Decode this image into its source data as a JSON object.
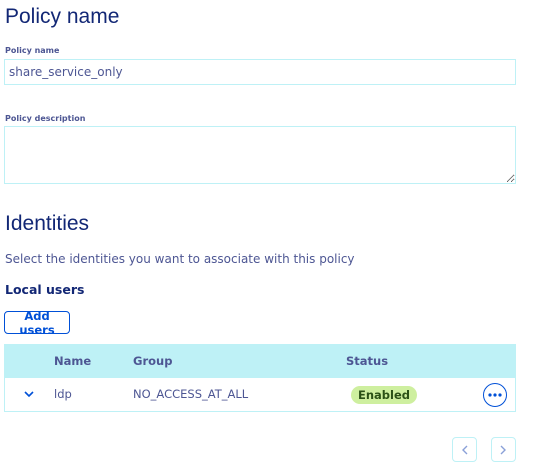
{
  "policy": {
    "heading": "Policy name",
    "name_label": "Policy name",
    "name_value": "share_service_only",
    "description_label": "Policy description",
    "description_value": ""
  },
  "identities": {
    "heading": "Identities",
    "description": "Select the identities you want to associate with this policy",
    "local_users_heading": "Local users",
    "add_users_label": "Add users",
    "table": {
      "headers": {
        "name": "Name",
        "group": "Group",
        "status": "Status"
      },
      "rows": [
        {
          "name": "ldp",
          "group": "NO_ACCESS_AT_ALL",
          "status": "Enabled"
        }
      ]
    }
  },
  "colors": {
    "accent": "#0050d7",
    "table_header_bg": "#bef1f6",
    "status_enabled_bg": "#ceef9f",
    "heading": "#122775"
  },
  "icons": {
    "row_expand": "chevron-down-icon",
    "row_actions": "more-horizontal-icon",
    "pager_prev": "chevron-left-icon",
    "pager_next": "chevron-right-icon"
  }
}
